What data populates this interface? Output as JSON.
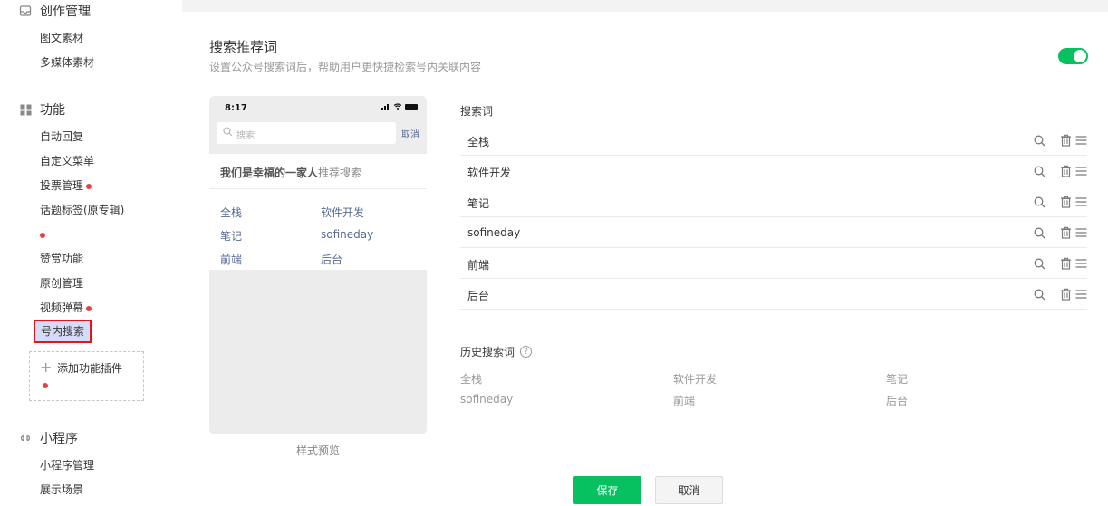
{
  "sidebar": {
    "groups": {
      "creation": {
        "title": "创作管理",
        "items": [
          "图文素材",
          "多媒体素材"
        ]
      },
      "features": {
        "title": "功能",
        "items": [
          "自动回复",
          "自定义菜单",
          "投票管理",
          "话题标签(原专辑)",
          "赞赏功能",
          "原创管理",
          "视频弹幕",
          "号内搜索"
        ]
      },
      "miniprogram": {
        "title": "小程序",
        "items": [
          "小程序管理",
          "展示场景"
        ]
      }
    },
    "add_plugin": "添加功能插件"
  },
  "panel": {
    "title": "搜索推荐词",
    "subtitle": "设置公众号搜索词后，帮助用户更快捷检索号内关联内容",
    "enabled": true,
    "accent_color": "#07c160"
  },
  "preview": {
    "time": "8:17",
    "search_placeholder": "搜索",
    "cancel": "取消",
    "account_name": "我们是幸福的一家人",
    "recommend_label": "推荐搜索",
    "chips": [
      "全栈",
      "软件开发",
      "笔记",
      "sofineday",
      "前端",
      "后台"
    ],
    "caption": "样式预览"
  },
  "keywords": {
    "label": "搜索词",
    "items": [
      "全栈",
      "软件开发",
      "笔记",
      "sofineday",
      "前端",
      "后台"
    ]
  },
  "history": {
    "label": "历史搜索词",
    "help": "?",
    "items": [
      "全栈",
      "软件开发",
      "笔记",
      "sofineday",
      "前端",
      "后台"
    ]
  },
  "actions": {
    "save": "保存",
    "cancel": "取消"
  }
}
